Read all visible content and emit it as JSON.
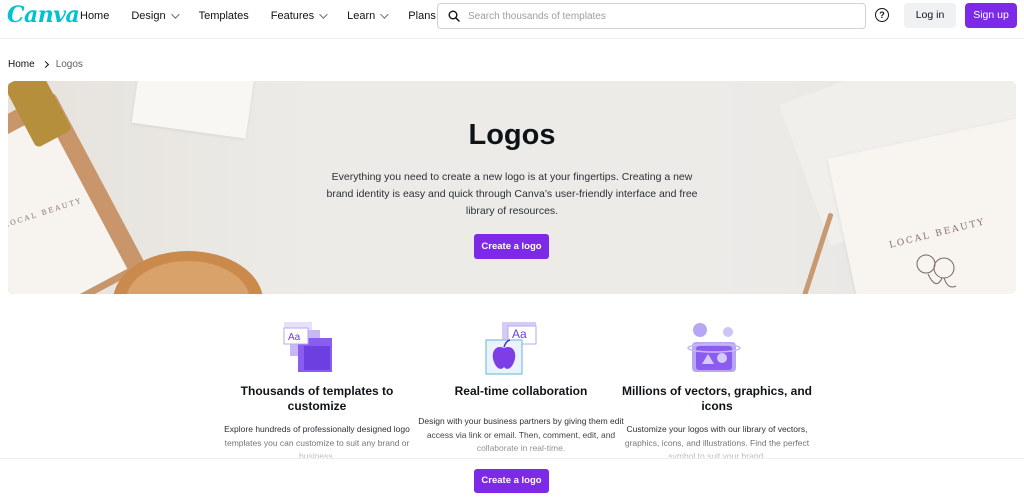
{
  "nav": {
    "logo": "Canva",
    "links": [
      {
        "label": "Home",
        "dropdown": false
      },
      {
        "label": "Design",
        "dropdown": true
      },
      {
        "label": "Templates",
        "dropdown": false
      },
      {
        "label": "Features",
        "dropdown": true
      },
      {
        "label": "Learn",
        "dropdown": true
      },
      {
        "label": "Plans",
        "dropdown": true
      }
    ],
    "search_placeholder": "Search thousands of templates",
    "help_icon": "?",
    "login_label": "Log in",
    "signup_label": "Sign up"
  },
  "breadcrumb": {
    "home": "Home",
    "current": "Logos"
  },
  "hero": {
    "title": "Logos",
    "description": "Everything you need to create a new logo is at your fingertips. Creating a new brand identity is easy and quick through Canva’s user-friendly interface and free library of resources.",
    "cta_label": "Create a logo",
    "stamp_text_left": "LOCAL BEAUTY",
    "stamp_text_right": "LOCAL BEAUTY"
  },
  "features": [
    {
      "icon": "templates-stack-icon",
      "title": "Thousands of templates to customize",
      "description": "Explore hundreds of professionally designed logo templates you can customize to suit any brand or business."
    },
    {
      "icon": "collaboration-icon",
      "title": "Real-time collaboration",
      "description": "Design with your business partners by giving them edit access via link or email. Then, comment, edit, and collaborate in real-time."
    },
    {
      "icon": "vectors-graphics-icon",
      "title": "Millions of vectors, graphics, and icons",
      "description": "Customize your logos with our library of vectors, graphics, icons, and illustrations. Find the perfect symbol to suit your brand."
    }
  ],
  "bottom_bar": {
    "cta_label": "Create a logo"
  },
  "colors": {
    "brand_purple": "#7d2ae8",
    "brand_teal": "#00c4cc",
    "text_dark": "#0e1318"
  }
}
